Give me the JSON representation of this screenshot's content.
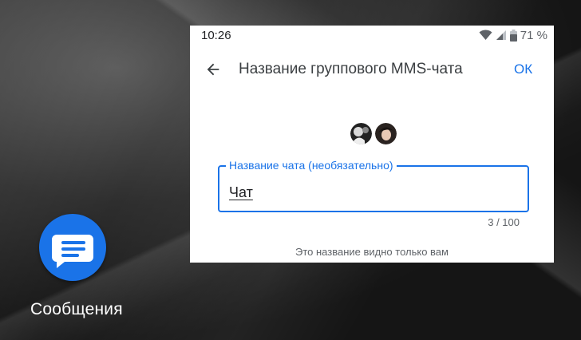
{
  "home": {
    "app_label": "Сообщения",
    "app_icon": "messages-icon",
    "accent": "#1a73e8"
  },
  "statusbar": {
    "time": "10:26",
    "battery": "71 %",
    "icons": [
      "wifi-icon",
      "signal-icon",
      "battery-icon"
    ]
  },
  "toolbar": {
    "title": "Название группового MMS-чата",
    "back_icon": "arrow-back-icon",
    "ok_label": "ОК"
  },
  "form": {
    "field_label": "Название чата (необязательно)",
    "field_value": "Чат",
    "counter": "3 / 100",
    "hint": "Это название видно только вам"
  }
}
